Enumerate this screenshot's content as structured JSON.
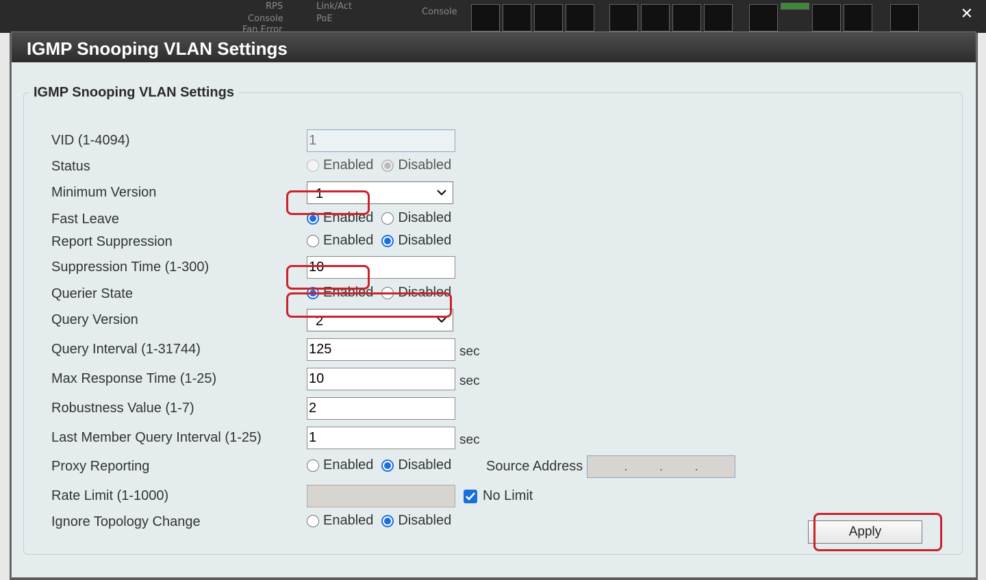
{
  "background": {
    "rps": "RPS",
    "console": "Console",
    "linkact": "Link/Act",
    "poe": "PoE",
    "console2": "Console",
    "faninfo": "Fan Error"
  },
  "dialog": {
    "title": "IGMP Snooping VLAN Settings",
    "group_title": "IGMP Snooping VLAN Settings"
  },
  "fields": {
    "vid": {
      "label": "VID (1-4094)",
      "value": "1"
    },
    "status": {
      "label": "Status",
      "opt_enabled": "Enabled",
      "opt_disabled": "Disabled",
      "selected": "Disabled"
    },
    "min_version": {
      "label": "Minimum Version",
      "value": "1"
    },
    "fast_leave": {
      "label": "Fast Leave",
      "opt_enabled": "Enabled",
      "opt_disabled": "Disabled",
      "selected": "Enabled"
    },
    "report_suppression": {
      "label": "Report Suppression",
      "opt_enabled": "Enabled",
      "opt_disabled": "Disabled",
      "selected": "Disabled"
    },
    "suppression_time": {
      "label": "Suppression Time (1-300)",
      "value": "10"
    },
    "querier_state": {
      "label": "Querier State",
      "opt_enabled": "Enabled",
      "opt_disabled": "Disabled",
      "selected": "Enabled"
    },
    "query_version": {
      "label": "Query Version",
      "value": "2"
    },
    "query_interval": {
      "label": "Query Interval (1-31744)",
      "value": "125",
      "unit": "sec"
    },
    "max_response": {
      "label": "Max Response Time (1-25)",
      "value": "10",
      "unit": "sec"
    },
    "robustness": {
      "label": "Robustness Value (1-7)",
      "value": "2"
    },
    "last_member": {
      "label": "Last Member Query Interval (1-25)",
      "value": "1",
      "unit": "sec"
    },
    "proxy_reporting": {
      "label": "Proxy Reporting",
      "opt_enabled": "Enabled",
      "opt_disabled": "Disabled",
      "selected": "Disabled",
      "source_label": "Source Address",
      "source_dot": "."
    },
    "rate_limit": {
      "label": "Rate Limit (1-1000)",
      "value": "",
      "no_limit_label": "No Limit",
      "no_limit_checked": true
    },
    "ignore_topology": {
      "label": "Ignore Topology Change",
      "opt_enabled": "Enabled",
      "opt_disabled": "Disabled",
      "selected": "Disabled"
    }
  },
  "apply_label": "Apply",
  "colors": {
    "highlight": "#c8232c",
    "accent": "#1a6fe0",
    "header": "#2c2c2c"
  }
}
